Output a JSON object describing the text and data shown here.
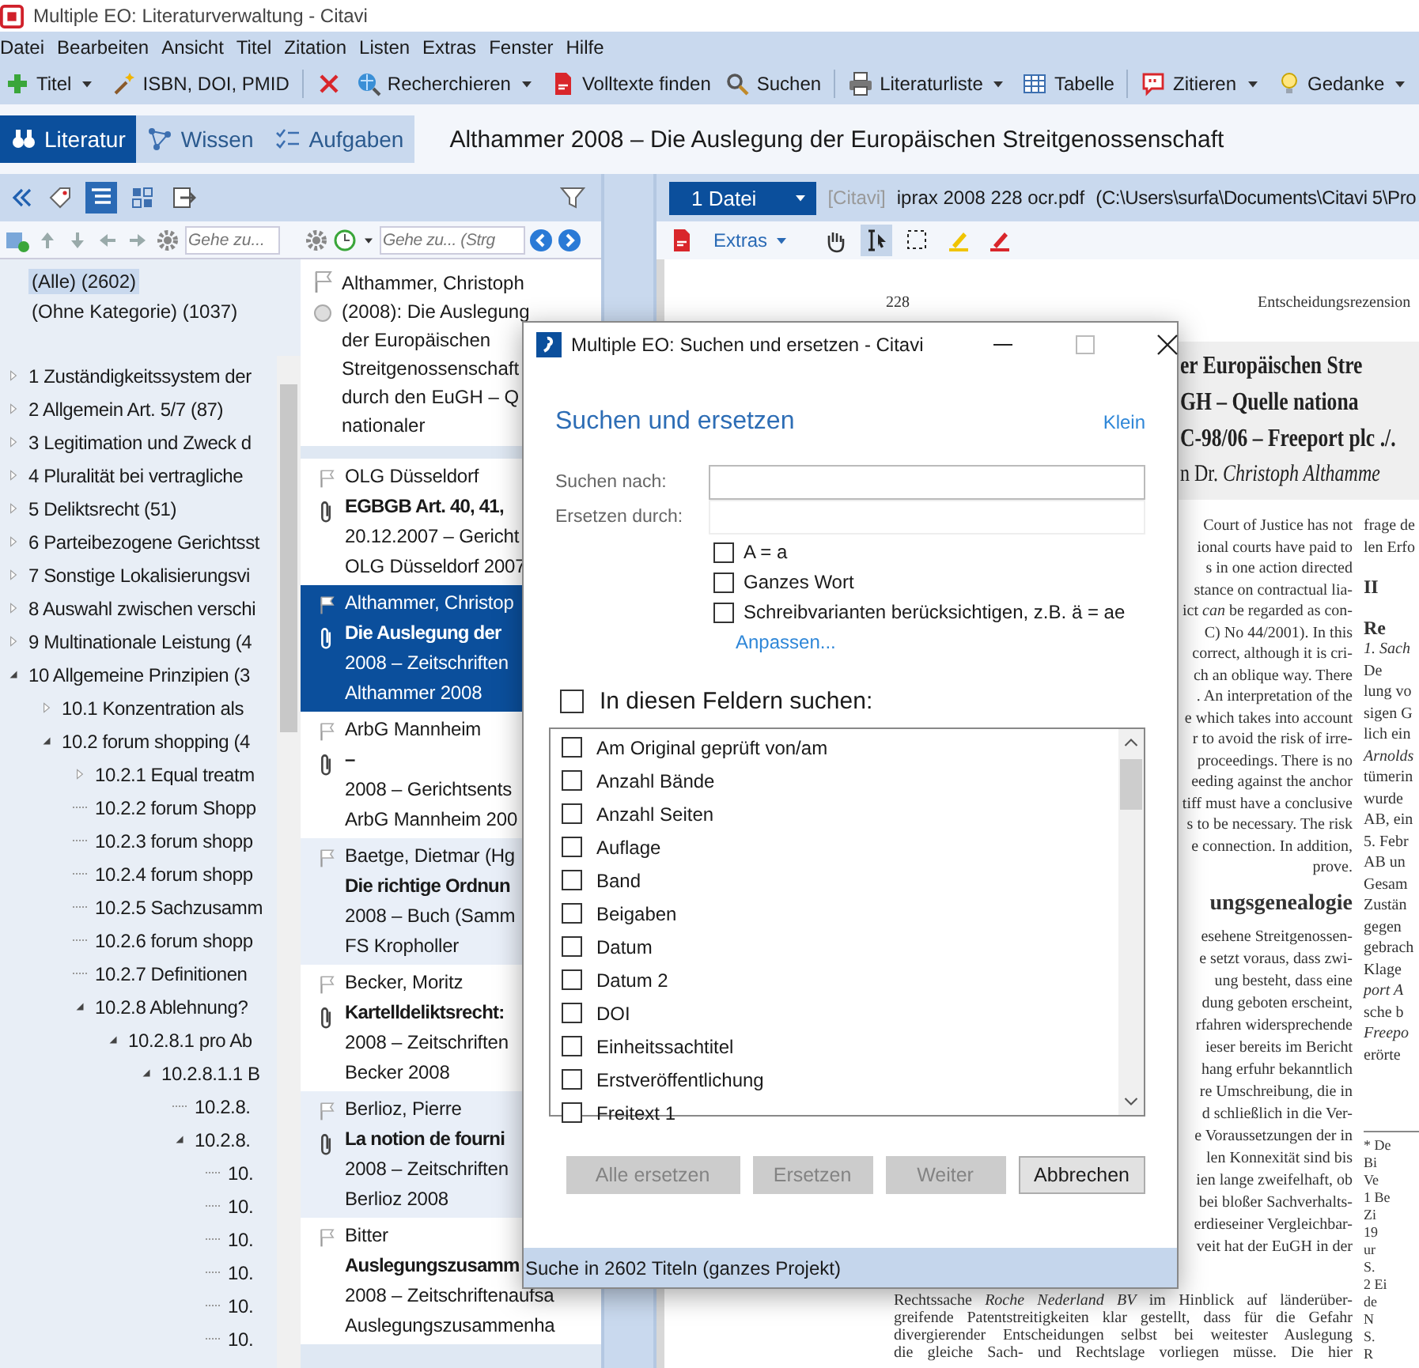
{
  "window": {
    "title": "Multiple EO: Literaturverwaltung - Citavi"
  },
  "menu": [
    "Datei",
    "Bearbeiten",
    "Ansicht",
    "Titel",
    "Zitation",
    "Listen",
    "Extras",
    "Fenster",
    "Hilfe"
  ],
  "toolbar": [
    [
      {
        "label": "Titel",
        "dropdown": true
      },
      {
        "label": "ISBN, DOI, PMID",
        "dropdown": false
      }
    ],
    [
      {
        "dropdown": false
      },
      {
        "label": "Recherchieren",
        "dropdown": true
      },
      {
        "label": "Volltexte finden",
        "dropdown": false
      },
      {
        "label": "Suchen",
        "dropdown": false
      }
    ],
    [
      {
        "label": "Literaturliste",
        "dropdown": true
      },
      {
        "label": "Tabelle",
        "dropdown": false
      }
    ],
    [
      {
        "label": "Zitieren",
        "dropdown": true
      },
      {
        "label": "Gedanke",
        "dropdown": true
      }
    ]
  ],
  "tabs": [
    {
      "label": "Literatur",
      "selected": true
    },
    {
      "label": "Wissen",
      "selected": false
    },
    {
      "label": "Aufgaben",
      "selected": false
    }
  ],
  "heading": "Althammer 2008 – Die Auslegung der Europäischen Streitgenossenschaft",
  "view_buttons": [
    {
      "selected": false
    },
    {
      "selected": true
    },
    {
      "selected": false
    },
    {
      "selected": false
    }
  ],
  "category_pane": {
    "goto_placeholder": "Gehe zu...",
    "top_items": [
      {
        "label": "(Alle) (2602)",
        "selected": true
      },
      {
        "label": "(Ohne Kategorie) (1037)",
        "selected": false
      }
    ],
    "tree": [
      {
        "label": "1 Zuständigkeitssystem der",
        "kind": "branch",
        "expanded": false
      },
      {
        "label": "2 Allgemein Art. 5/7 (87)",
        "kind": "branch",
        "expanded": false
      },
      {
        "label": "3 Legitimation und Zweck d",
        "kind": "branch",
        "expanded": false
      },
      {
        "label": "4 Pluralität bei vertragliche",
        "kind": "branch",
        "expanded": false
      },
      {
        "label": "5 Deliktsrecht (51)",
        "kind": "branch",
        "expanded": false
      },
      {
        "label": "6 Parteibezogene Gerichtsst",
        "kind": "branch",
        "expanded": false
      },
      {
        "label": "7 Sonstige Lokalisierungsvi",
        "kind": "branch",
        "expanded": false
      },
      {
        "label": "8 Auswahl zwischen verschi",
        "kind": "branch",
        "expanded": false
      },
      {
        "label": "9 Multinationale Leistung (4",
        "kind": "branch",
        "expanded": false
      },
      {
        "label": "10 Allgemeine Prinzipien (3",
        "kind": "branch",
        "expanded": true,
        "children": [
          {
            "label": "10.1 Konzentration als",
            "kind": "branch",
            "expanded": false
          },
          {
            "label": "10.2 forum shopping (4",
            "kind": "branch",
            "expanded": true,
            "children": [
              {
                "label": "10.2.1 Equal treatm",
                "kind": "branch",
                "expanded": false
              },
              {
                "label": "10.2.2 forum Shopp",
                "kind": "leaf"
              },
              {
                "label": "10.2.3 forum shopp",
                "kind": "leaf"
              },
              {
                "label": "10.2.4 forum shopp",
                "kind": "leaf"
              },
              {
                "label": "10.2.5 Sachzusamm",
                "kind": "leaf"
              },
              {
                "label": "10.2.6 forum shopp",
                "kind": "leaf"
              },
              {
                "label": "10.2.7 Definitionen",
                "kind": "leaf"
              },
              {
                "label": "10.2.8 Ablehnung?",
                "kind": "branch",
                "expanded": true,
                "children": [
                  {
                    "label": "10.2.8.1 pro Ab",
                    "kind": "branch",
                    "expanded": true,
                    "children": [
                      {
                        "label": "10.2.8.1.1 B",
                        "kind": "branch",
                        "expanded": true,
                        "children": [
                          {
                            "label": "10.2.8.",
                            "kind": "leaf"
                          },
                          {
                            "label": "10.2.8.",
                            "kind": "branch",
                            "expanded": true,
                            "children": [
                              {
                                "label": "10.",
                                "kind": "leaf"
                              },
                              {
                                "label": "10.",
                                "kind": "leaf"
                              },
                              {
                                "label": "10.",
                                "kind": "leaf"
                              },
                              {
                                "label": "10.",
                                "kind": "leaf"
                              },
                              {
                                "label": "10.",
                                "kind": "leaf"
                              },
                              {
                                "label": "10.",
                                "kind": "leaf"
                              }
                            ]
                          }
                        ]
                      }
                    ]
                  }
                ]
              }
            ]
          }
        ]
      }
    ]
  },
  "reference_pane": {
    "goto_placeholder": "Gehe zu... (Strg",
    "preview_lines": [
      "Althammer, Christoph",
      "(2008): Die Auslegung",
      "der Europäischen",
      "Streitgenossenschaft",
      "durch den EuGH – Q",
      "nationaler"
    ],
    "references": [
      {
        "author": "OLG Düsseldorf",
        "title": "EGBGB Art. 40, 41,",
        "info": "20.12.2007 – Gericht",
        "short_title": "OLG Düsseldorf 2007",
        "attachment": true,
        "selected": false
      },
      {
        "author": "Althammer, Christop",
        "title": "Die Auslegung der",
        "info": "2008 – Zeitschriften",
        "short_title": "Althammer 2008",
        "attachment": true,
        "selected": true
      },
      {
        "author": "ArbG Mannheim",
        "title": "–",
        "info": "2008 – Gerichtsents",
        "short_title": "ArbG Mannheim 200",
        "attachment": true,
        "selected": false
      },
      {
        "author": "Baetge, Dietmar (Hg",
        "title": "Die richtige Ordnun",
        "info": "2008 – Buch (Samm",
        "short_title": "FS Kropholler",
        "attachment": false,
        "selected": false
      },
      {
        "author": "Becker, Moritz",
        "title": "Kartelldeliktsrecht:",
        "info": "2008 – Zeitschriften",
        "short_title": "Becker 2008",
        "attachment": true,
        "selected": false
      },
      {
        "author": "Berlioz, Pierre",
        "title": "La notion de fourni",
        "info": "2008 – Zeitschriften",
        "short_title": "Berlioz 2008",
        "attachment": true,
        "selected": false
      },
      {
        "author": "Bitter",
        "title": "Auslegungszusamm",
        "info": "2008 – Zeitschriftenaufsa",
        "short_title": "Auslegungszusammenha",
        "attachment": false,
        "selected": false
      }
    ]
  },
  "pdf_pane": {
    "file_button": "1 Datei",
    "source": "[Citavi]",
    "file_name": "iprax 2008 228 ocr.pdf",
    "path": "(C:\\Users\\surfa\\Documents\\Citavi 5\\Pro",
    "extras": "Extras",
    "tools": [
      {
        "selected": false
      },
      {
        "selected": true
      },
      {
        "selected": false
      },
      {
        "selected": false
      },
      {
        "selected": false
      }
    ]
  },
  "pdf_page": {
    "page_number": "228",
    "running_head": "Entscheidungsrezension",
    "title_lines": [
      "er Europäischen Stre",
      "GH – Quelle nationa",
      "C-98/06 – Freeport plc ./.",
      "n Dr. *Christoph Althamme*"
    ],
    "column_1_lines": [
      "Court of Justice has not",
      "ional courts have paid to",
      "s in one action directed",
      "stance on contractual lia-",
      "ict *can* be regarded as con-",
      "C) No 44/2001). In this",
      "correct, although it is cri-",
      "ch an oblique way. There",
      ". An interpretation of the",
      "e which takes into account",
      "r to avoid the risk of irre-",
      "proceedings. There is no",
      "eeding against the anchor",
      "tiff must have a conclusive",
      "s to be necessary. The risk",
      "e connection. In addition,",
      "prove."
    ],
    "column_1_heading": "ungsgenealogie",
    "column_1_lines_2": [
      "esehene Streitgenossen-",
      "e setzt voraus, dass zwi-",
      "ung besteht, dass eine",
      "dung geboten erscheint,",
      "rfahren widersprechende",
      "ieser bereits im Bericht",
      "hang erfuhr bekanntlich",
      "re Umschreibung, die in",
      "d schließlich in die Ver-",
      "e Voraussetzungen der in",
      "len Konnexität sind bis",
      "ien lange zweifelhaft, ob",
      "bei bloßer Sachverhalts-",
      "erdieseiner Vergleichbar-",
      "veit hat der EuGH in der"
    ],
    "column_1_bottom_lines": [
      "Rechtssache *Roche Nederland BV* im Hinblick auf länderüber-",
      "greifende Patentstreitigkeiten klar gestellt, dass für die Gefahr",
      "divergierender Entscheidungen selbst bei weitester Auslegung",
      "die gleiche Sach- und Rechtslage vorliegen müsse. Die hier"
    ],
    "column_2_lines": [
      {
        "text": "frage de",
        "kind": "body"
      },
      {
        "text": "len Erfo",
        "kind": "body"
      },
      {
        "text": "II",
        "kind": "heading"
      },
      {
        "text": "Re",
        "kind": "heading"
      },
      {
        "text": "1. Sach",
        "kind": "italic"
      },
      {
        "text": "De",
        "kind": "body"
      },
      {
        "text": "lung vo",
        "kind": "body"
      },
      {
        "text": "sigen G",
        "kind": "body"
      },
      {
        "text": "lich ein",
        "kind": "body"
      },
      {
        "text": "Arnolds",
        "kind": "italic"
      },
      {
        "text": "tümerin",
        "kind": "body"
      },
      {
        "text": "wurde",
        "kind": "body"
      },
      {
        "text": "AB, ein",
        "kind": "body"
      },
      {
        "text": "5. Febr",
        "kind": "body"
      },
      {
        "text": "AB un",
        "kind": "body"
      },
      {
        "text": "Gesam",
        "kind": "body"
      },
      {
        "text": "Zustän",
        "kind": "body"
      },
      {
        "text": "gegen",
        "kind": "body"
      },
      {
        "text": "gebrach",
        "kind": "body"
      },
      {
        "text": "Klage",
        "kind": "body"
      },
      {
        "text": "port A",
        "kind": "italic"
      },
      {
        "text": "sche b",
        "kind": "body"
      },
      {
        "text": "Freepo",
        "kind": "italic"
      },
      {
        "text": "erörte",
        "kind": "body"
      }
    ],
    "footnotes": [
      "* De",
      "Bi",
      "Ve",
      "1 Be",
      "Zi",
      "19",
      "ur",
      "S.",
      "2 Ei",
      "de",
      "N",
      "S.",
      "R"
    ]
  },
  "dialog": {
    "title": "Multiple EO: Suchen und ersetzen - Citavi",
    "heading": "Suchen und ersetzen",
    "size_link": "Klein",
    "search_label": "Suchen nach:",
    "replace_label": "Ersetzen durch:",
    "options": [
      {
        "label": "A = a",
        "checked": false
      },
      {
        "label": "Ganzes Wort",
        "checked": false
      },
      {
        "label": "Schreibvarianten berücksichtigen, z.B. ä = ae",
        "checked": false
      }
    ],
    "customize_link": "Anpassen...",
    "fields_toggle": {
      "label": "In diesen Feldern suchen:",
      "checked": false
    },
    "fields": [
      {
        "label": "Am Original geprüft von/am",
        "checked": false
      },
      {
        "label": "Anzahl Bände",
        "checked": false
      },
      {
        "label": "Anzahl Seiten",
        "checked": false
      },
      {
        "label": "Auflage",
        "checked": false
      },
      {
        "label": "Band",
        "checked": false
      },
      {
        "label": "Beigaben",
        "checked": false
      },
      {
        "label": "Datum",
        "checked": false
      },
      {
        "label": "Datum 2",
        "checked": false
      },
      {
        "label": "DOI",
        "checked": false
      },
      {
        "label": "Einheitssachtitel",
        "checked": false
      },
      {
        "label": "Erstveröffentlichung",
        "checked": false
      },
      {
        "label": "Freitext 1",
        "checked": false
      }
    ],
    "buttons": [
      {
        "label": "Alle ersetzen",
        "disabled": true
      },
      {
        "label": "Ersetzen",
        "disabled": true
      },
      {
        "label": "Weiter",
        "disabled": true
      },
      {
        "label": "Abbrechen",
        "disabled": false
      }
    ],
    "status": "Suche in 2602 Titeln (ganzes Projekt)"
  }
}
